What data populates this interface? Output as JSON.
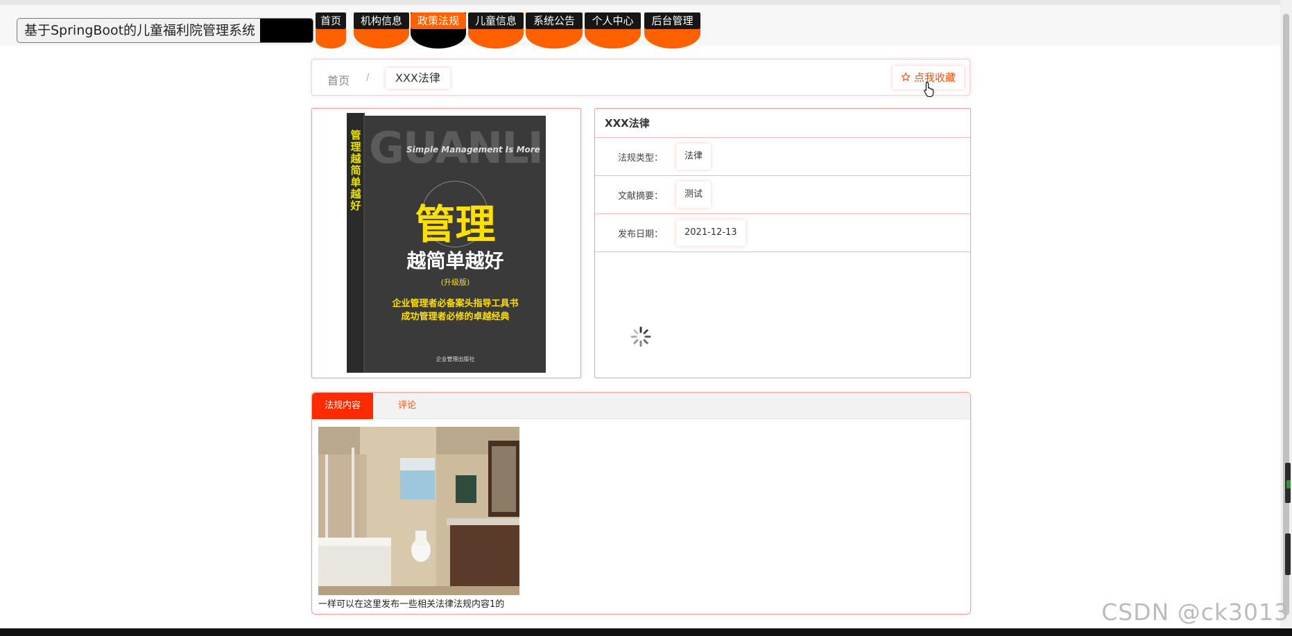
{
  "header": {
    "site_title": "基于SpringBoot的儿童福利院管理系统",
    "nav": [
      {
        "label": "首页",
        "active": false
      },
      {
        "label": "机构信息",
        "active": false
      },
      {
        "label": "政策法规",
        "active": true
      },
      {
        "label": "儿童信息",
        "active": false
      },
      {
        "label": "系统公告",
        "active": false
      },
      {
        "label": "个人中心",
        "active": false
      },
      {
        "label": "后台管理",
        "active": false
      }
    ]
  },
  "breadcrumb": {
    "home": "首页",
    "separator": "/",
    "current": "XXX法律"
  },
  "favorite": {
    "icon": "star-outline-icon",
    "label": "点我收藏"
  },
  "book_cover": {
    "spine_text": "管理越简单越好",
    "big_text": "GUANLI",
    "subtitle_en": "Simple Management Is More",
    "main_title": "管理",
    "sub_title": "越简单越好",
    "edition": "(升级版)",
    "line1": "企业管理者必备案头指导工具书",
    "line2": "成功管理者必修的卓越经典",
    "publisher": "企业管理出版社"
  },
  "info": {
    "title": "XXX法律",
    "rows": [
      {
        "label": "法规类型：",
        "value": "法律"
      },
      {
        "label": "文献摘要：",
        "value": "测试"
      },
      {
        "label": "发布日期：",
        "value": "2021-12-13"
      }
    ]
  },
  "tabs": [
    {
      "label": "法规内容",
      "active": true
    },
    {
      "label": "评论",
      "active": false
    }
  ],
  "content": {
    "text": "一样可以在这里发布一些相关法律法规内容1的"
  },
  "watermark": "CSDN @ck3013",
  "colors": {
    "accent": "#ff6000",
    "active_tab": "#ff2a00",
    "border": "#ff9999"
  }
}
